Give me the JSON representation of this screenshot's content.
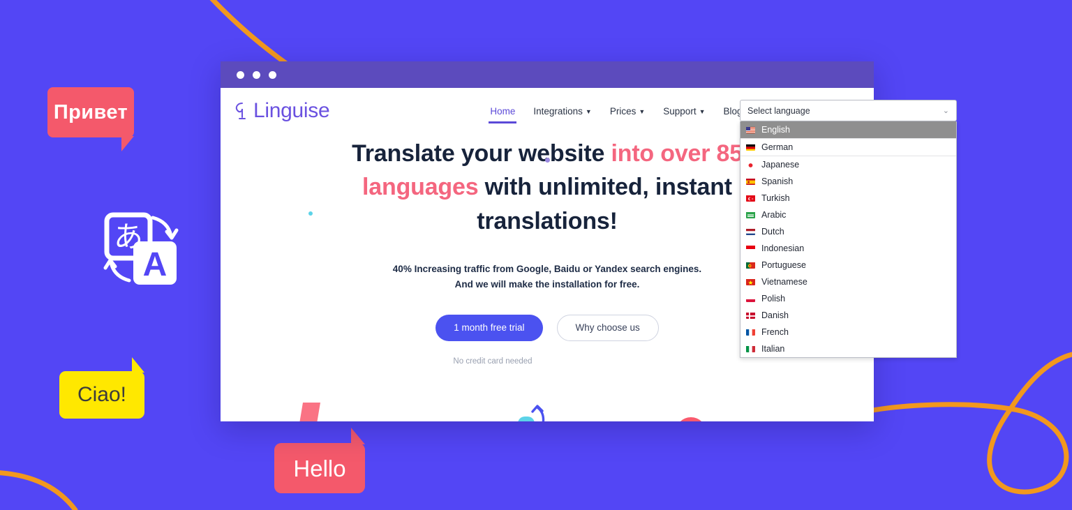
{
  "page_background_color": "#5346f5",
  "decor": {
    "bubbles": [
      {
        "id": "privet",
        "text": "Привет",
        "bg": "#f4596b",
        "color": "#ffffff"
      },
      {
        "id": "ciao",
        "text": "Ciao!",
        "bg": "#ffe800",
        "color": "#3c3c3c"
      },
      {
        "id": "hello",
        "text": "Hello",
        "bg": "#f4596b",
        "color": "#ffffff"
      }
    ],
    "swoosh_color": "#f2981e",
    "translate_icon_glyphs": {
      "source": "あ",
      "target": "A"
    }
  },
  "browser": {
    "titlebar_color": "#5c4bbd",
    "dots": [
      "window-dot",
      "window-dot",
      "window-dot"
    ]
  },
  "site": {
    "logo": {
      "text": "Linguise",
      "color": "#6a51e0"
    },
    "nav": [
      {
        "label": "Home",
        "has_caret": false,
        "active": true
      },
      {
        "label": "Integrations",
        "has_caret": true,
        "active": false
      },
      {
        "label": "Prices",
        "has_caret": true,
        "active": false
      },
      {
        "label": "Support",
        "has_caret": true,
        "active": false
      },
      {
        "label": "Blog",
        "has_caret": true,
        "active": false
      }
    ],
    "hero": {
      "headline_part1": "Translate your website ",
      "headline_highlight1": "into over 85 languages",
      "headline_part2": " with unlimited, instant translations!",
      "highlight_color": "#f4667f",
      "subhead_line1": "40% Increasing traffic from Google, Baidu or Yandex search engines.",
      "subhead_line2": "And we will make the installation for free.",
      "primary_button": "1 month free trial",
      "secondary_button": "Why choose us",
      "no_credit_note": "No credit card needed",
      "primary_button_color": "#4b52f0"
    }
  },
  "language_widget": {
    "placeholder": "Select language",
    "selected_index": 0,
    "options": [
      {
        "label": "English",
        "flag": "us"
      },
      {
        "label": "German",
        "flag": "de"
      },
      {
        "label": "Japanese",
        "flag": "jp"
      },
      {
        "label": "Spanish",
        "flag": "es"
      },
      {
        "label": "Turkish",
        "flag": "tr"
      },
      {
        "label": "Arabic",
        "flag": "sa"
      },
      {
        "label": "Dutch",
        "flag": "nl"
      },
      {
        "label": "Indonesian",
        "flag": "id"
      },
      {
        "label": "Portuguese",
        "flag": "pt"
      },
      {
        "label": "Vietnamese",
        "flag": "vn"
      },
      {
        "label": "Polish",
        "flag": "pl"
      },
      {
        "label": "Danish",
        "flag": "dk"
      },
      {
        "label": "French",
        "flag": "fr"
      },
      {
        "label": "Italian",
        "flag": "it"
      }
    ]
  }
}
